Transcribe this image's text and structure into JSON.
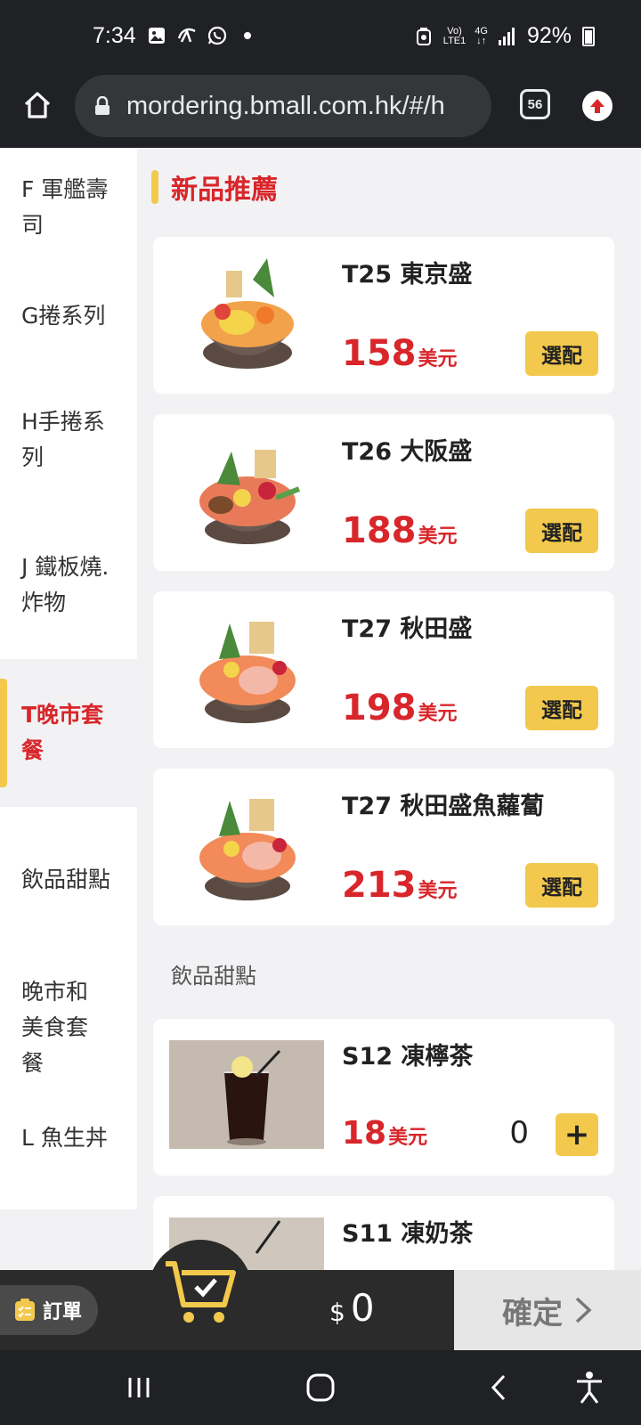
{
  "status_bar": {
    "time": "7:34",
    "battery": "92%",
    "network_line1": "Vo)",
    "network_line2": "LTE1",
    "network_type": "4G",
    "icons": [
      "gallery-icon",
      "news-icon",
      "whatsapp-icon",
      "dot-icon",
      "vpn-icon",
      "signal-icon",
      "battery-icon"
    ]
  },
  "browser": {
    "url": "mordering.bmall.com.hk/#/h",
    "tab_count": "56"
  },
  "sidebar": {
    "items": [
      {
        "label": "F 軍艦壽司"
      },
      {
        "label": "G捲系列"
      },
      {
        "label": "H手捲系列"
      },
      {
        "label": "J 鐵板燒.炸物"
      },
      {
        "label": "T晚市套餐"
      },
      {
        "label": "飲品甜點"
      },
      {
        "label": "晚市和美食套餐"
      },
      {
        "label": "L 魚生丼"
      }
    ]
  },
  "main": {
    "section_title": "新品推薦",
    "section2_title": "飲品甜點",
    "products": [
      {
        "name": "T25 東京盛",
        "price": "158",
        "currency": "美元",
        "action": "選配"
      },
      {
        "name": "T26 大阪盛",
        "price": "188",
        "currency": "美元",
        "action": "選配"
      },
      {
        "name": "T27 秋田盛",
        "price": "198",
        "currency": "美元",
        "action": "選配"
      },
      {
        "name": "T27 秋田盛魚蘿蔔",
        "price": "213",
        "currency": "美元",
        "action": "選配"
      }
    ],
    "drinks": [
      {
        "name": "S12 凍檸茶",
        "price": "18",
        "currency": "美元",
        "qty": "0",
        "plus": "+"
      },
      {
        "name": "S11 凍奶茶"
      }
    ]
  },
  "cart": {
    "orders_label": "訂單",
    "currency_symbol": "$",
    "total": "0",
    "confirm_label": "確定"
  },
  "colors": {
    "accent": "#f2c94c",
    "price_red": "#d8262a",
    "dark_bar": "#2b2b2b"
  }
}
